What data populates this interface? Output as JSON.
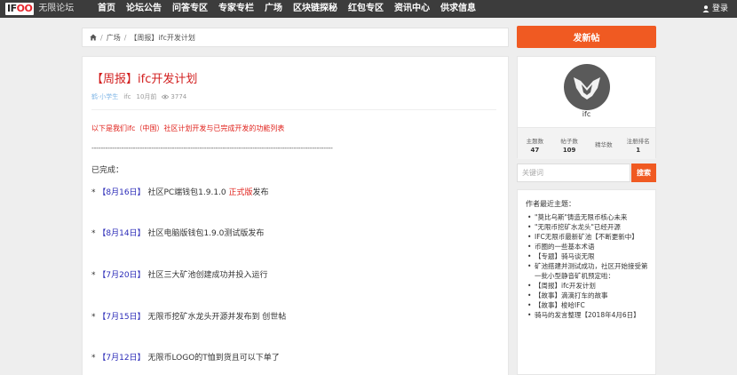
{
  "header": {
    "logo_text": "IFOO",
    "site_name": "无限论坛",
    "nav": [
      "首页",
      "论坛公告",
      "问答专区",
      "专家专栏",
      "广场",
      "区块链探秘",
      "红包专区",
      "资讯中心",
      "供求信息"
    ],
    "login": "登录"
  },
  "breadcrumb": {
    "home_icon": "home-icon",
    "items": [
      "广场",
      "【周报】ifc开发计划"
    ]
  },
  "post": {
    "title": "【周报】ifc开发计划",
    "author": "鹤·小学生",
    "tag": "ifc",
    "time": "10月前",
    "views": "3774",
    "intro": "以下是我们ifc（中国）社区计划开发与已完成开发的功能列表",
    "dashes": "---------------------------------------------------------------------------------------------------------",
    "done_label": "已完成：",
    "entries": [
      {
        "bullet": "*",
        "date": "【8月16日】",
        "text": "社区PC端钱包1.9.1.0 ",
        "highlight": "正式版",
        "suffix": "发布"
      },
      {
        "bullet": "*",
        "date": "【8月14日】",
        "text": "社区电脑版钱包1.9.0测试版发布"
      },
      {
        "bullet": "*",
        "date": "【7月20日】",
        "text": "社区三大矿池创建成功并投入运行"
      },
      {
        "bullet": "*",
        "date": "【7月15日】",
        "text": "无限币挖矿水龙头开源并发布到 创世帖"
      },
      {
        "bullet": "*",
        "date": "【7月12日】",
        "text": "无限币LOGO的T恤到货且可以下单了"
      }
    ]
  },
  "sidebar": {
    "new_post": "发新帖",
    "profile": {
      "name": "ifc",
      "stats": [
        {
          "label": "主题数",
          "value": "47"
        },
        {
          "label": "帖子数",
          "value": "109"
        },
        {
          "label": "精华数",
          "value": ""
        },
        {
          "label": "注册排名",
          "value": "1"
        }
      ]
    },
    "search": {
      "placeholder": "关键词",
      "button": "搜索"
    },
    "recent": {
      "title": "作者最近主题：",
      "items": [
        "\"莫比乌斯\"铸造无限币核心未来",
        "\"无限币挖矿水龙头\"已经开源",
        "IFC无限币最新矿池【不断更新中】",
        "币圈的一些基本术语",
        "【专题】骑马谈无限",
        "矿池搭建并测试成功，社区开始接受第一批小型静音矿机预定啦：",
        "【周报】ifc开发计划",
        "【故事】滴滴打车的故事",
        "【故事】梭哈IFC",
        "骑马的发言整理【2018年4月6日】"
      ]
    }
  },
  "colors": {
    "accent": "#f05a22",
    "title_red": "#d21f1f",
    "date_blue": "#2b2bb8",
    "nav_bg": "#3c3c3c"
  }
}
